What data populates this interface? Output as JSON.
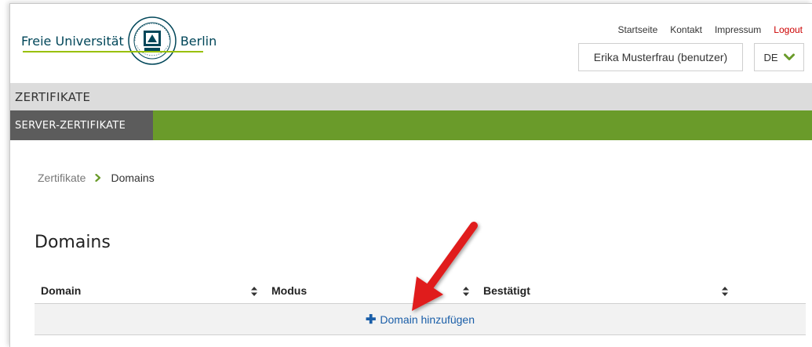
{
  "header": {
    "logo_left": "Freie Universität",
    "logo_right": "Berlin",
    "nav": {
      "home": "Startseite",
      "contact": "Kontakt",
      "imprint": "Impressum",
      "logout": "Logout"
    },
    "user": "Erika Musterfrau (benutzer)",
    "language": "DE"
  },
  "section_bar": "ZERTIFIKATE",
  "subnav_tab": "SERVER-ZERTIFIKATE",
  "breadcrumb": {
    "parent": "Zertifikate",
    "current": "Domains"
  },
  "page_title": "Domains",
  "table": {
    "columns": [
      "Domain",
      "Modus",
      "Bestätigt"
    ],
    "add_label": "Domain hinzufügen",
    "add_icon": "plus-icon"
  },
  "colors": {
    "accent_green": "#6a9b2a",
    "tab_grey": "#5c5c5c",
    "link_blue": "#1a5ea8",
    "logout_red": "#cc0000",
    "annotation_arrow": "#e01b1b"
  },
  "icons": {
    "seal": "university-seal-icon",
    "language_chevron": "chevron-down-icon",
    "breadcrumb_separator": "chevron-right-icon",
    "sort": "sort-icon",
    "annotation": "red-arrow-icon"
  }
}
